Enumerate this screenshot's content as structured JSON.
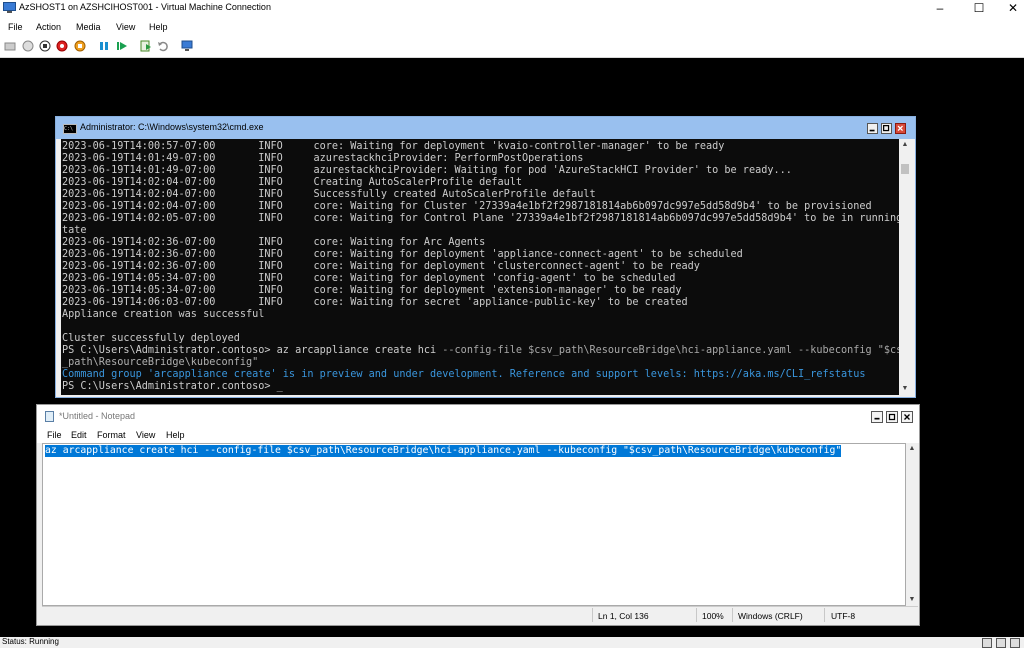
{
  "host": {
    "title": "AzSHOST1 on AZSHCIHOST001 - Virtual Machine Connection",
    "menu": [
      "File",
      "Action",
      "Media",
      "View",
      "Help"
    ],
    "controls": {
      "minimize": "–",
      "maximize": "☐",
      "close": "✕"
    },
    "status": "Status: Running"
  },
  "cmd": {
    "title": "Administrator: C:\\Windows\\system32\\cmd.exe",
    "lines": [
      "2023-06-19T14:00:57-07:00       INFO     core: Waiting for deployment 'kvaio-controller-manager' to be ready",
      "2023-06-19T14:01:49-07:00       INFO     azurestackhciProvider: PerformPostOperations",
      "2023-06-19T14:01:49-07:00       INFO     azurestackhciProvider: Waiting for pod 'AzureStackHCI Provider' to be ready...",
      "2023-06-19T14:02:04-07:00       INFO     Creating AutoScalerProfile default",
      "2023-06-19T14:02:04-07:00       INFO     Successfully created AutoScalerProfile default",
      "2023-06-19T14:02:04-07:00       INFO     core: Waiting for Cluster '27339a4e1bf2f2987181814ab6b097dc997e5dd58d9b4' to be provisioned",
      "2023-06-19T14:02:05-07:00       INFO     core: Waiting for Control Plane '27339a4e1bf2f2987181814ab6b097dc997e5dd58d9b4' to be in running s",
      "tate",
      "2023-06-19T14:02:36-07:00       INFO     core: Waiting for Arc Agents",
      "2023-06-19T14:02:36-07:00       INFO     core: Waiting for deployment 'appliance-connect-agent' to be scheduled",
      "2023-06-19T14:02:36-07:00       INFO     core: Waiting for deployment 'clusterconnect-agent' to be ready",
      "2023-06-19T14:05:34-07:00       INFO     core: Waiting for deployment 'config-agent' to be scheduled",
      "2023-06-19T14:05:34-07:00       INFO     core: Waiting for deployment 'extension-manager' to be ready",
      "2023-06-19T14:06:03-07:00       INFO     core: Waiting for secret 'appliance-public-key' to be created",
      "Appliance creation was successful",
      "",
      "Cluster successfully deployed"
    ],
    "prompt1": "PS C:\\Users\\Administrator.contoso> az arcappliance create hci ",
    "args1": "--config-file $csv_path\\ResourceBridge\\hci-appliance.yaml --kubeconfig \"$csv",
    "args1b": "_path\\ResourceBridge\\kubeconfig\"",
    "warning": "Command group 'arcappliance create' is in preview and under development. Reference and support levels: https://aka.ms/CLI_refstatus",
    "prompt2": "PS C:\\Users\\Administrator.contoso> _"
  },
  "notepad": {
    "title": "*Untitled - Notepad",
    "menu": [
      "File",
      "Edit",
      "Format",
      "View",
      "Help"
    ],
    "content": "az arcappliance create hci --config-file $csv_path\\ResourceBridge\\hci-appliance.yaml --kubeconfig \"$csv_path\\ResourceBridge\\kubeconfig\"",
    "status": {
      "position": "Ln 1, Col 136",
      "zoom": "100%",
      "line_ending": "Windows (CRLF)",
      "encoding": "UTF-8"
    }
  }
}
